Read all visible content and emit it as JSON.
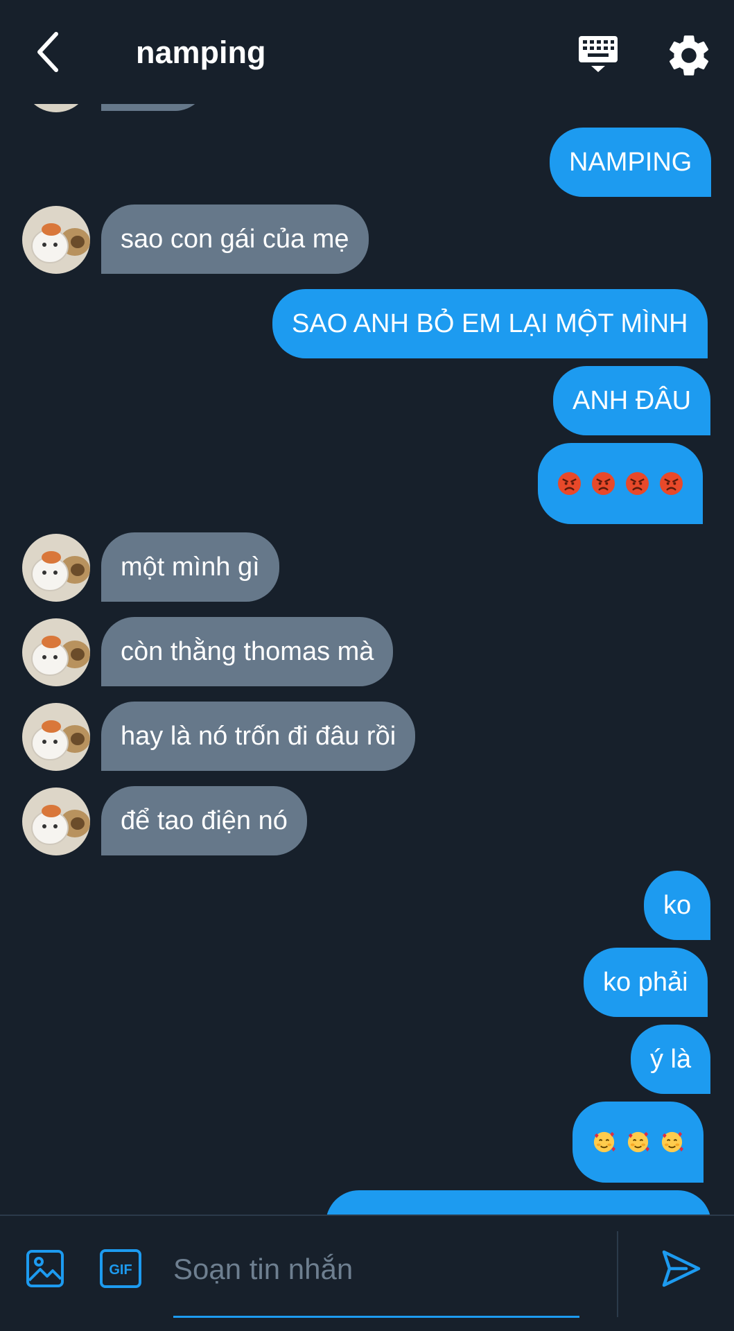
{
  "header": {
    "title": "namping",
    "back_icon": "chevron-left-icon",
    "keyboard_icon": "keyboard-icon",
    "settings_icon": "gear-icon"
  },
  "messages": [
    {
      "side": "out",
      "text": "NAMPING"
    },
    {
      "side": "in",
      "text": "sao con gái của mẹ"
    },
    {
      "side": "out",
      "text": "SAO ANH BỎ EM LẠI MỘT MÌNH"
    },
    {
      "side": "out",
      "text": "ANH ĐÂU"
    },
    {
      "side": "out",
      "emoji": "angry-face",
      "count": 4
    },
    {
      "side": "in",
      "text": "một mình gì"
    },
    {
      "side": "in",
      "text": "còn thằng thomas mà"
    },
    {
      "side": "in",
      "text": "hay là nó trốn đi đâu rồi"
    },
    {
      "side": "in",
      "text": "để tao điện nó"
    },
    {
      "side": "out",
      "text": "ko"
    },
    {
      "side": "out",
      "text": "ko phải"
    },
    {
      "side": "out",
      "text": "ý là"
    },
    {
      "side": "out",
      "emoji": "smiling-face-with-hearts",
      "count": 3
    }
  ],
  "composer": {
    "placeholder": "Soạn tin nhắn",
    "image_icon": "image-icon",
    "gif_label": "GIF",
    "send_icon": "send-icon"
  },
  "colors": {
    "background": "#17202b",
    "outgoing_bubble": "#1d9bf0",
    "incoming_bubble": "#66788a",
    "accent": "#1d9bf0"
  }
}
